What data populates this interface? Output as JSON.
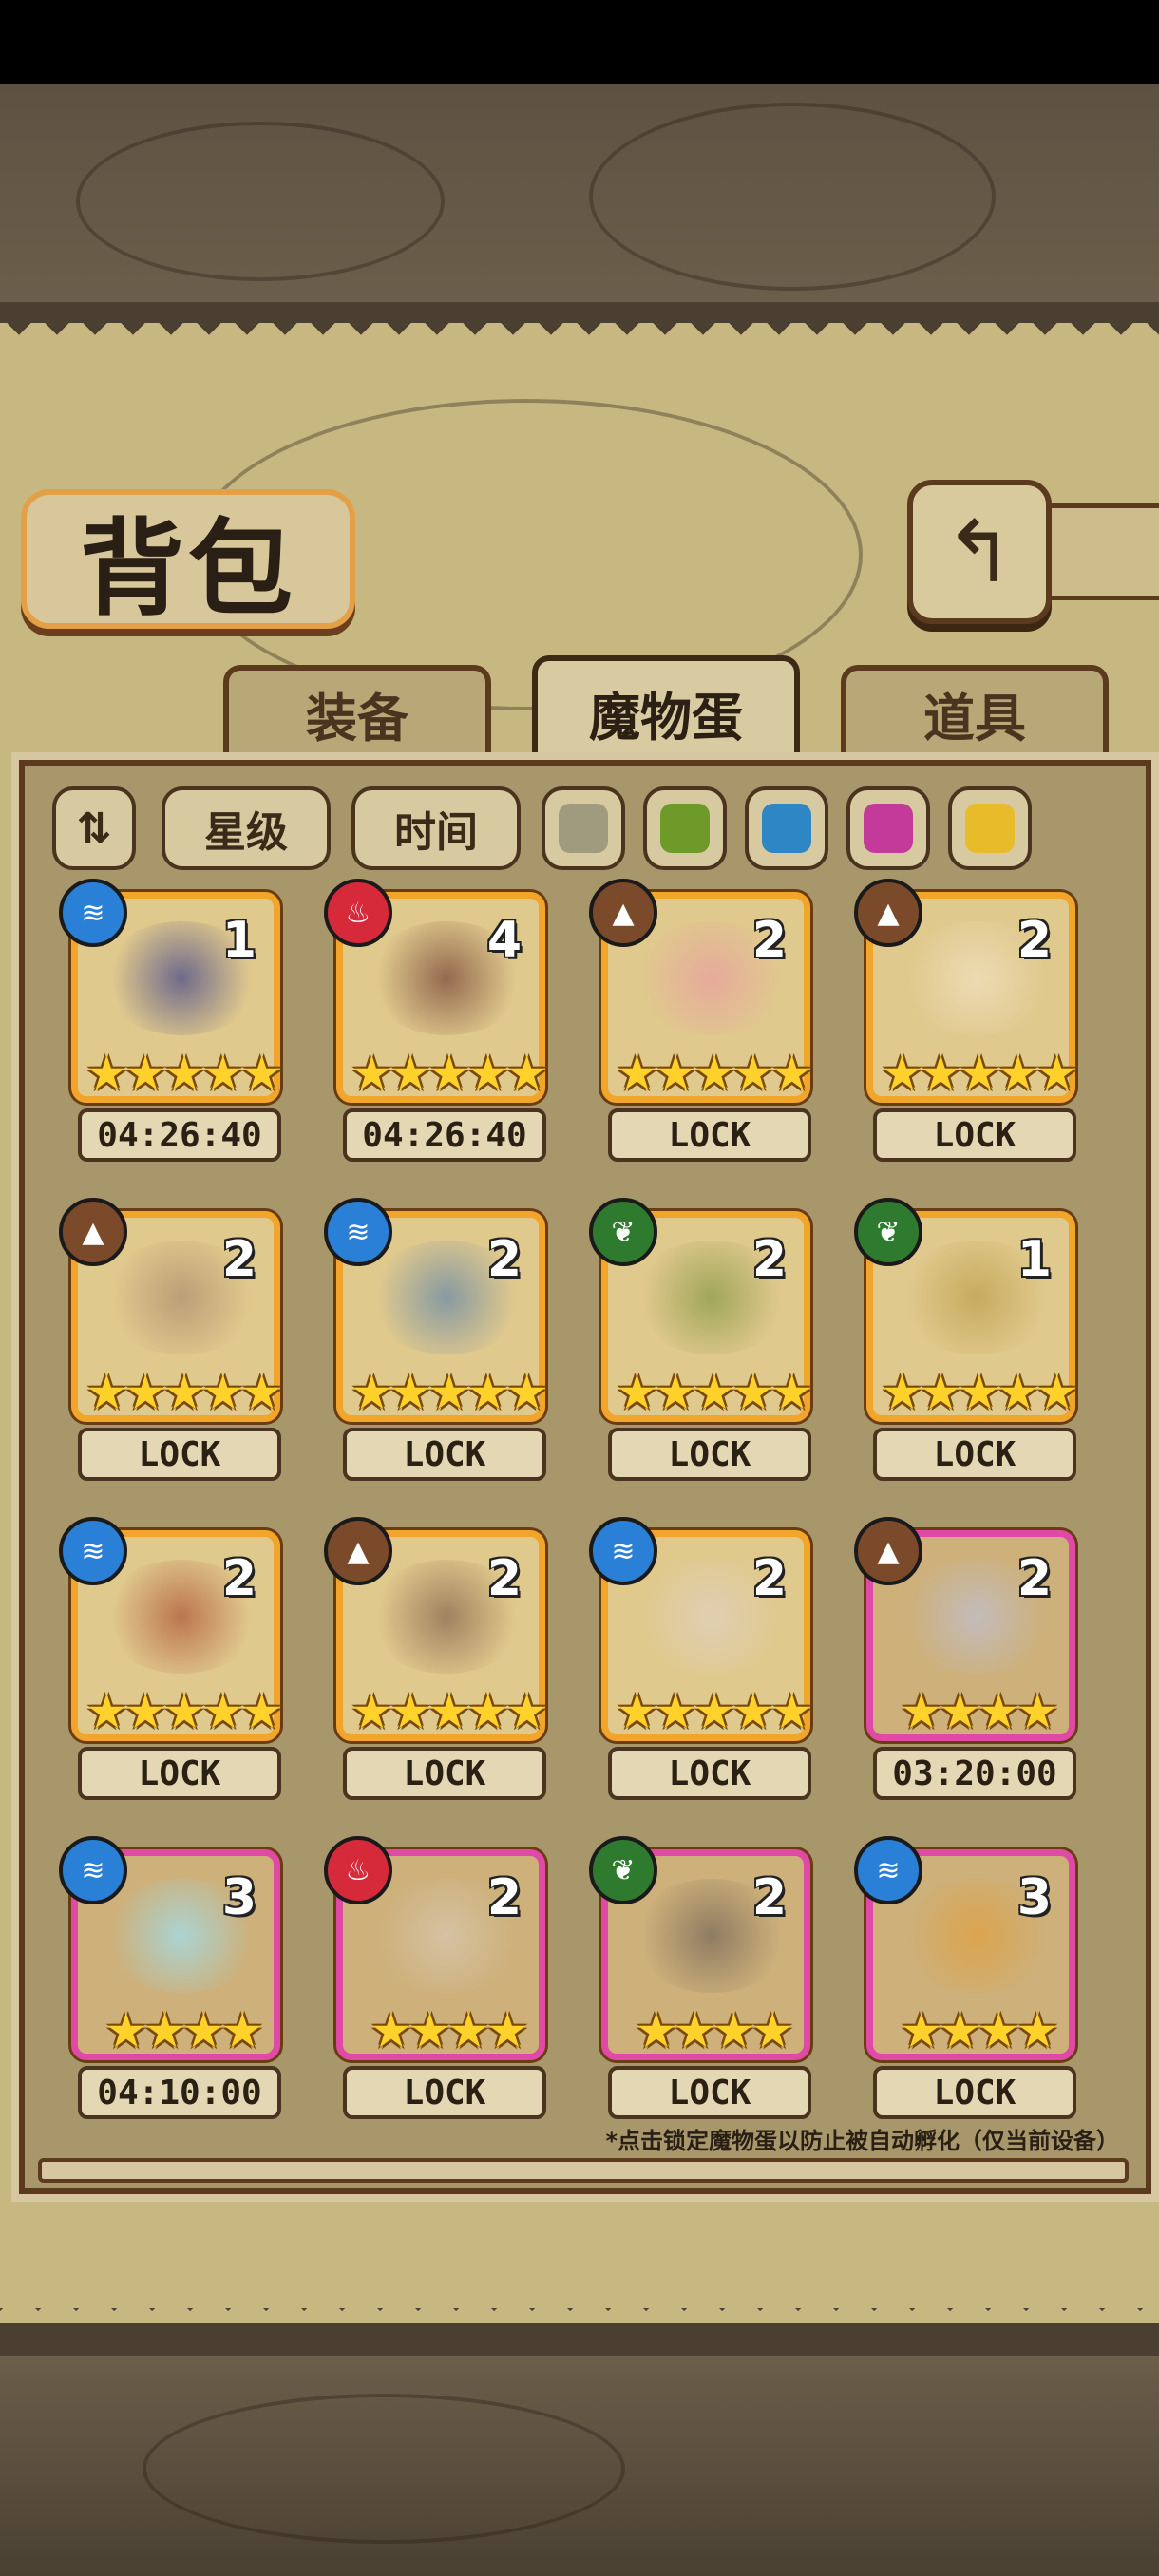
{
  "title": "背包",
  "tabs": [
    {
      "label": "装备",
      "active": false
    },
    {
      "label": "魔物蛋",
      "active": true
    },
    {
      "label": "道具",
      "active": false
    }
  ],
  "filters": {
    "sort_icon": "sort-icon",
    "star_label": "星级",
    "time_label": "时间",
    "colors": [
      "#a09a7e",
      "#6e9a2a",
      "#2e86c4",
      "#c43a9a",
      "#e8bb2a"
    ]
  },
  "element_colors": {
    "water": "#2a7fd6",
    "fire": "#d62a3a",
    "earth": "#7a4a2a",
    "nature": "#2e7a2e"
  },
  "element_glyphs": {
    "water": "≋",
    "fire": "♨",
    "earth": "▲",
    "nature": "❦"
  },
  "eggs": [
    {
      "element": "water",
      "count": "1",
      "stars": "★★★★★",
      "label": "04:26:40",
      "frame": "gold",
      "art": "#4a4a8a"
    },
    {
      "element": "fire",
      "count": "4",
      "stars": "★★★★★",
      "label": "04:26:40",
      "frame": "gold",
      "art": "#7a4a3a"
    },
    {
      "element": "earth",
      "count": "2",
      "stars": "★★★★★",
      "label": "LOCK",
      "frame": "gold",
      "art": "#e8a0a0"
    },
    {
      "element": "earth",
      "count": "2",
      "stars": "★★★★★",
      "label": "LOCK",
      "frame": "gold",
      "art": "#f0e0c0"
    },
    {
      "element": "earth",
      "count": "2",
      "stars": "★★★★★",
      "label": "LOCK",
      "frame": "gold",
      "art": "#b09070"
    },
    {
      "element": "water",
      "count": "2",
      "stars": "★★★★★",
      "label": "LOCK",
      "frame": "gold",
      "art": "#6a8aa8"
    },
    {
      "element": "nature",
      "count": "2",
      "stars": "★★★★★",
      "label": "LOCK",
      "frame": "gold",
      "art": "#8a9a4a"
    },
    {
      "element": "nature",
      "count": "1",
      "stars": "★★★★★",
      "label": "LOCK",
      "frame": "gold",
      "art": "#c0a050"
    },
    {
      "element": "water",
      "count": "2",
      "stars": "★★★★★",
      "label": "LOCK",
      "frame": "gold",
      "art": "#b05a3a"
    },
    {
      "element": "earth",
      "count": "2",
      "stars": "★★★★★",
      "label": "LOCK",
      "frame": "gold",
      "art": "#8a6a50"
    },
    {
      "element": "water",
      "count": "2",
      "stars": "★★★★★",
      "label": "LOCK",
      "frame": "gold",
      "art": "#e0d0c0"
    },
    {
      "element": "earth",
      "count": "2",
      "stars": "★★★★",
      "label": "03:20:00",
      "frame": "purple",
      "art": "#c0c0d0"
    },
    {
      "element": "water",
      "count": "3",
      "stars": "★★★★",
      "label": "04:10:00",
      "frame": "purple",
      "art": "#9fe0f0"
    },
    {
      "element": "fire",
      "count": "2",
      "stars": "★★★★",
      "label": "LOCK",
      "frame": "purple",
      "art": "#d8c8b0"
    },
    {
      "element": "nature",
      "count": "2",
      "stars": "★★★★",
      "label": "LOCK",
      "frame": "purple",
      "art": "#7a6a5a"
    },
    {
      "element": "water",
      "count": "3",
      "stars": "★★★★",
      "label": "LOCK",
      "frame": "purple",
      "art": "#e0a040"
    }
  ],
  "note": "*点击锁定魔物蛋以防止被自动孵化（仅当前设备）"
}
